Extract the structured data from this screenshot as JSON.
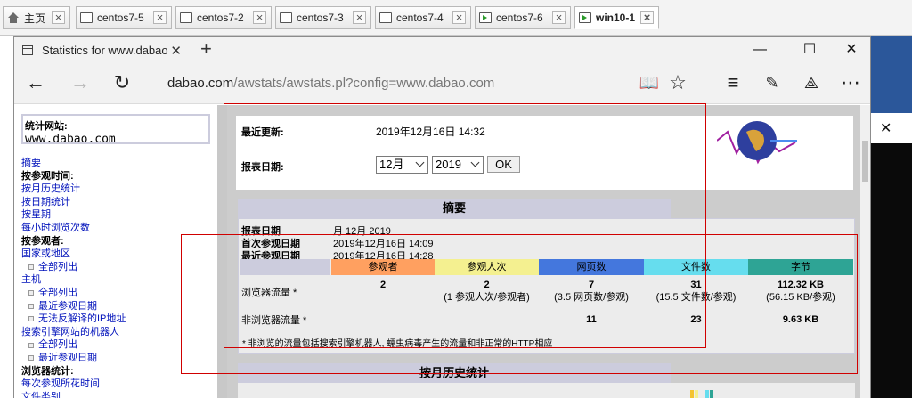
{
  "host_tabs": [
    {
      "label": "主页",
      "icon": "home-icon",
      "active": false
    },
    {
      "label": "centos7-5",
      "icon": "vm-icon",
      "active": false
    },
    {
      "label": "centos7-2",
      "icon": "vm-icon",
      "active": false
    },
    {
      "label": "centos7-3",
      "icon": "vm-icon",
      "active": false
    },
    {
      "label": "centos7-4",
      "icon": "vm-icon",
      "active": false
    },
    {
      "label": "centos7-6",
      "icon": "vm-running-icon",
      "active": false
    },
    {
      "label": "win10-1",
      "icon": "vm-running-icon",
      "active": true
    }
  ],
  "browser": {
    "tab_title": "Statistics for www.dabao",
    "url_host": "dabao.com",
    "url_rest": "/awstats/awstats.pl?config=www.dabao.com"
  },
  "sidebar": {
    "site_label": "统计网站:",
    "site_value": "www.dabao.com",
    "items": [
      {
        "text": "摘要",
        "type": "link"
      },
      {
        "text": "按参观时间:",
        "type": "heading"
      },
      {
        "text": "按月历史统计",
        "type": "link"
      },
      {
        "text": "按日期统计",
        "type": "link"
      },
      {
        "text": "按星期",
        "type": "link"
      },
      {
        "text": "每小时浏览次数",
        "type": "link"
      },
      {
        "text": "按参观者:",
        "type": "heading"
      },
      {
        "text": "国家或地区",
        "type": "link"
      },
      {
        "text": "全部列出",
        "type": "sublink"
      },
      {
        "text": "主机",
        "type": "link"
      },
      {
        "text": "全部列出",
        "type": "sublink"
      },
      {
        "text": "最近参观日期",
        "type": "sublink"
      },
      {
        "text": "无法反解译的IP地址",
        "type": "sublink"
      },
      {
        "text": "搜索引擎网站的机器人",
        "type": "link"
      },
      {
        "text": "全部列出",
        "type": "sublink"
      },
      {
        "text": "最近参观日期",
        "type": "sublink"
      },
      {
        "text": "浏览器统计:",
        "type": "heading"
      },
      {
        "text": "每次参观所花时间",
        "type": "link"
      },
      {
        "text": "文件类别",
        "type": "link"
      }
    ]
  },
  "header": {
    "last_update_label": "最近更新:",
    "last_update_value": "2019年12月16日 14:32",
    "report_date_label": "报表日期:",
    "month_selected": "12月",
    "year_selected": "2019",
    "ok_label": "OK"
  },
  "summary": {
    "title": "摘要",
    "rows": [
      {
        "label": "报表日期",
        "value": "月 12月 2019"
      },
      {
        "label": "首次参观日期",
        "value": "2019年12月16日 14:09"
      },
      {
        "label": "最近参观日期",
        "value": "2019年12月16日 14:28"
      }
    ],
    "columns": [
      {
        "label": "参观者",
        "color": "#ffa060"
      },
      {
        "label": "参观人次",
        "color": "#f4f090"
      },
      {
        "label": "网页数",
        "color": "#4477dd"
      },
      {
        "label": "文件数",
        "color": "#66ddee"
      },
      {
        "label": "字节",
        "color": "#2ea495"
      }
    ],
    "viewed_label": "浏览器流量 *",
    "viewed": [
      {
        "main": "2",
        "sub": ""
      },
      {
        "main": "2",
        "sub": "(1 参观人次/参观者)"
      },
      {
        "main": "7",
        "sub": "(3.5 网页数/参观)"
      },
      {
        "main": "31",
        "sub": "(15.5 文件数/参观)"
      },
      {
        "main": "112.32 KB",
        "sub": "(56.15 KB/参观)"
      }
    ],
    "notviewed_label": "非浏览器流量 *",
    "notviewed": [
      "",
      "",
      "11",
      "23",
      "9.63 KB"
    ],
    "note": "* 非浏览的流量包括搜索引擎机器人, 蠕虫病毒产生的流量和非正常的HTTP相应"
  },
  "monthly": {
    "title": "按月历史统计"
  },
  "colors": {
    "label_bg": "#ccccdd",
    "frame_bg": "#cccccc",
    "link": "#0011bb",
    "annotation_red": "#d00000"
  }
}
